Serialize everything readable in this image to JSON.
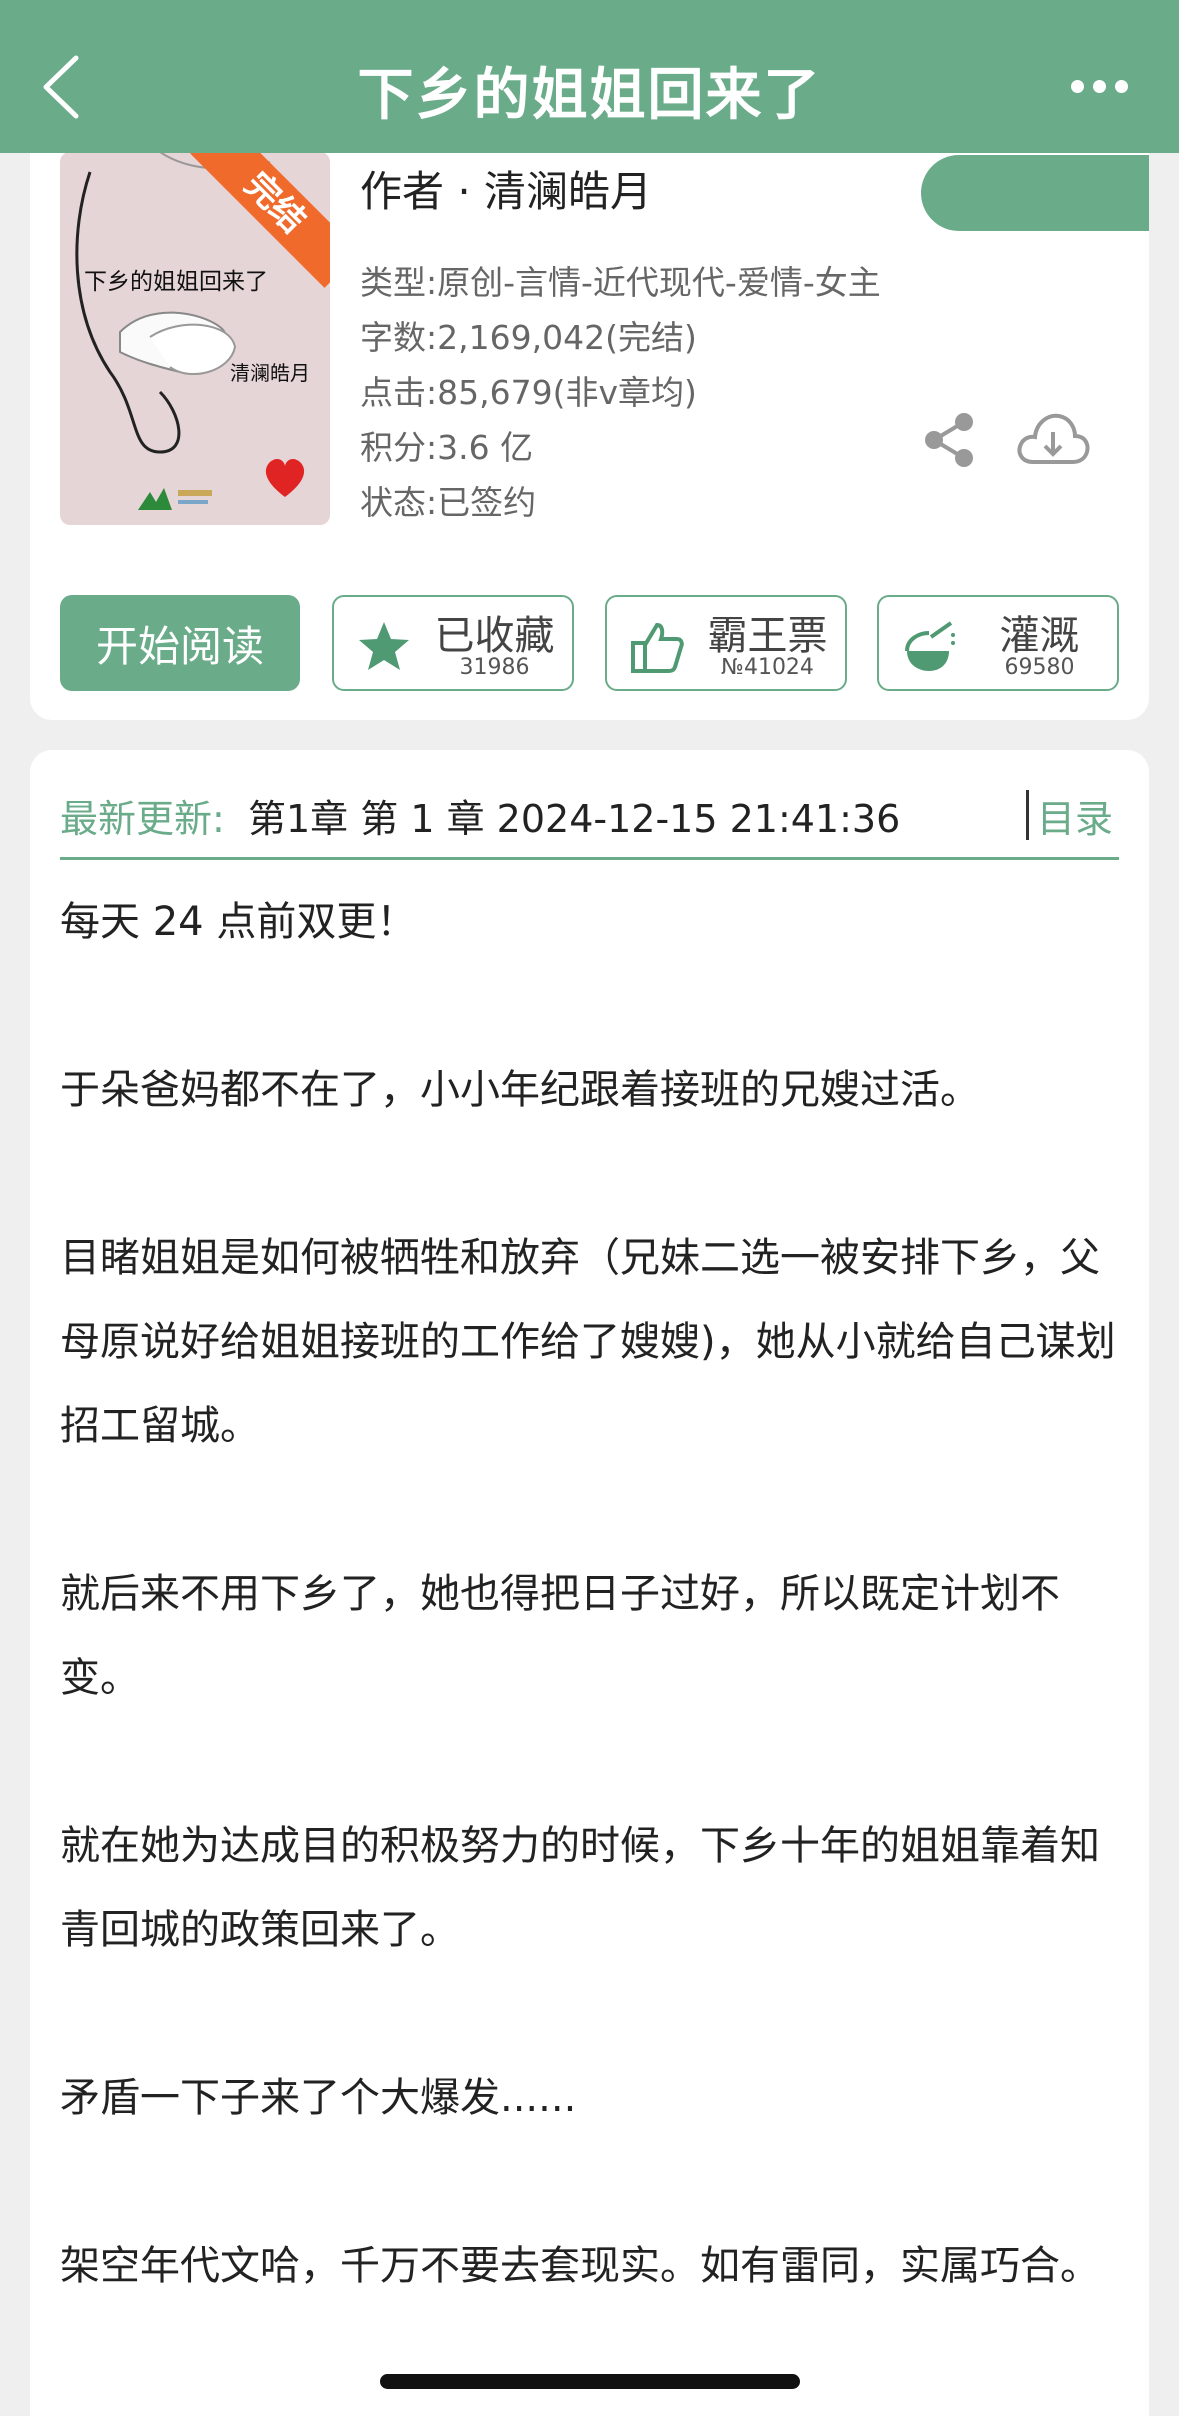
{
  "header": {
    "title": "下乡的姐姐回来了"
  },
  "book": {
    "cover_title": "下乡的姐姐回来了",
    "cover_author": "清澜皓月",
    "cover_badge": "完结",
    "author_line": "作者 · 清澜皓月",
    "type_line": "类型:原创-言情-近代现代-爱情-女主",
    "words_line": "字数:2,169,042(完结)",
    "clicks_line": "点击:85,679(非v章均)",
    "score_line": "积分:3.6 亿",
    "status_line": "状态:已签约"
  },
  "actions": {
    "read_label": "开始阅读",
    "collect_label": "已收藏",
    "collect_count": "31986",
    "vote_label": "霸王票",
    "vote_count": "№41024",
    "water_label": "灌溉",
    "water_count": "69580"
  },
  "update": {
    "label": "最新更新:",
    "text": "第1章 第 1 章 2024-12-15 21:41:36",
    "toc_label": "目录"
  },
  "summary": [
    "每天 24 点前双更！",
    "于朵爸妈都不在了，小小年纪跟着接班的兄嫂过活。",
    "目睹姐姐是如何被牺牲和放弃（兄妹二选一被安排下乡，父母原说好给姐姐接班的工作给了嫂嫂)，她从小就给自己谋划招工留城。",
    "就后来不用下乡了，她也得把日子过好，所以既定计划不变。",
    "就在她为达成目的积极努力的时候，下乡十年的姐姐靠着知青回城的政策回来了。",
    "矛盾一下子来了个大爆发......",
    "架空年代文哈，千万不要去套现实。如有雷同，实属巧合。"
  ],
  "colors": {
    "accent": "#6aab8a",
    "badge": "#f06a2c"
  },
  "icons": [
    "back-arrow-icon",
    "more-icon",
    "share-icon",
    "download-icon",
    "star-icon",
    "thumbs-up-icon",
    "watering-icon"
  ]
}
